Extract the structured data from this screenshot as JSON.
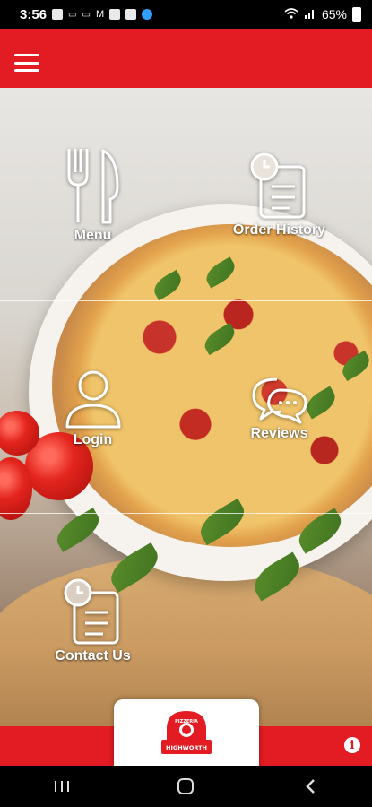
{
  "status_bar": {
    "time": "3:56",
    "notifications": [
      "image-icon",
      "chat-icon",
      "chat-icon",
      "mail-icon",
      "gallery-icon",
      "photo-icon",
      "messenger-icon"
    ],
    "battery": "65%"
  },
  "tiles": {
    "menu": "Menu",
    "order_history": "Order History",
    "login": "Login",
    "reviews": "Reviews",
    "contact_us": "Contact Us"
  },
  "logo": {
    "top_text": "PIZZERIA",
    "bottom_text": "HIGHWORTH"
  },
  "colors": {
    "brand_red": "#e31b23"
  },
  "nav": [
    "recents-icon",
    "home-icon",
    "back-icon"
  ]
}
